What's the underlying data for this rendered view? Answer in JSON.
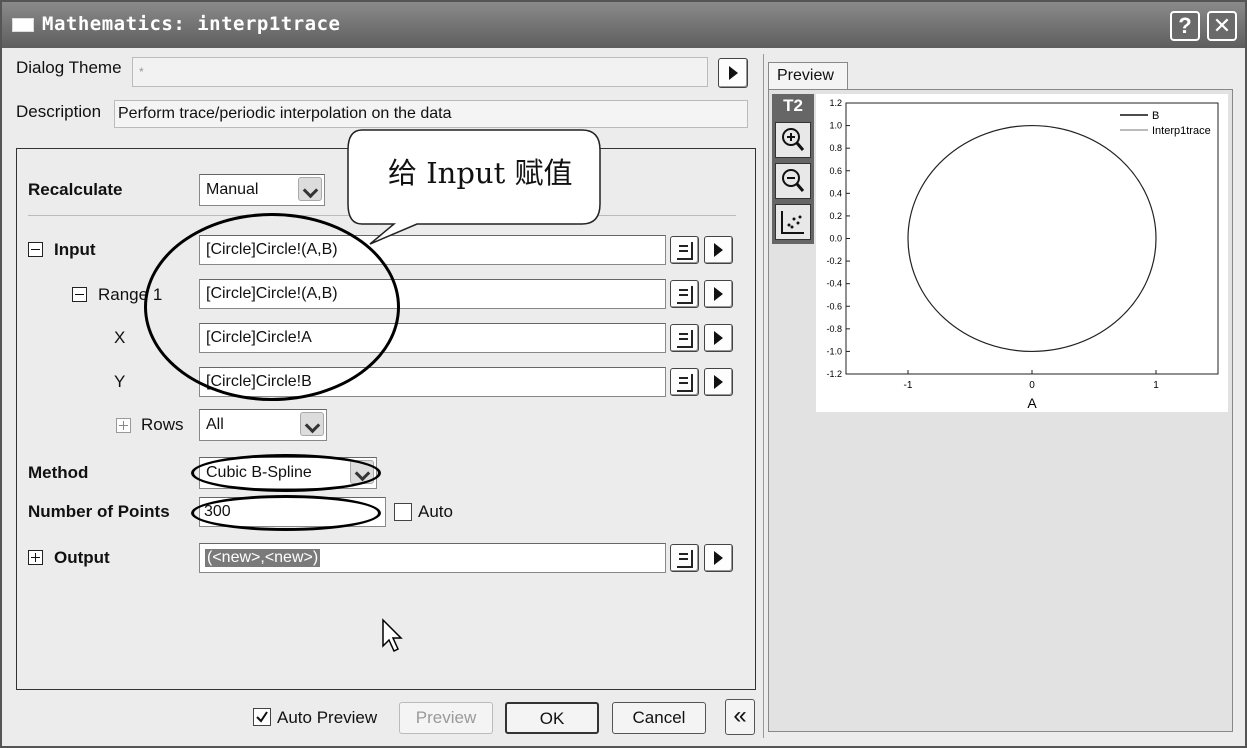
{
  "window": {
    "title": "Mathematics: interp1trace",
    "help_glyph": "?",
    "close_glyph": "✕"
  },
  "dialog_theme": {
    "label": "Dialog Theme",
    "value": "*"
  },
  "description": {
    "label": "Description",
    "value": "Perform trace/periodic interpolation on the data"
  },
  "callout": {
    "text": "给 Input 赋值"
  },
  "form": {
    "recalculate": {
      "label": "Recalculate",
      "value": "Manual"
    },
    "input": {
      "label": "Input",
      "value": "[Circle]Circle!(A,B)"
    },
    "range1": {
      "label": "Range 1",
      "value": "[Circle]Circle!(A,B)"
    },
    "x": {
      "label": "X",
      "value": "[Circle]Circle!A"
    },
    "y": {
      "label": "Y",
      "value": "[Circle]Circle!B"
    },
    "rows": {
      "label": "Rows",
      "value": "All"
    },
    "method": {
      "label": "Method",
      "value": "Cubic B-Spline"
    },
    "num_points": {
      "label": "Number of Points",
      "value": "300",
      "auto_label": "Auto",
      "auto_checked": false
    },
    "output": {
      "label": "Output",
      "value": "(<new>,<new>)"
    }
  },
  "bottom": {
    "auto_preview_label": "Auto Preview",
    "auto_preview_checked": true,
    "preview_button": "Preview",
    "ok_button": "OK",
    "cancel_button": "Cancel",
    "collapse_glyph": "«"
  },
  "preview": {
    "tab_label": "Preview",
    "layer_label": "T2",
    "legend": [
      "B",
      "Interp1trace"
    ],
    "x_axis_title": "A",
    "x_ticks": [
      "-1",
      "0",
      "1"
    ],
    "y_ticks": [
      "1.2",
      "1.0",
      "0.8",
      "0.6",
      "0.4",
      "0.2",
      "0.0",
      "-0.2",
      "-0.4",
      "-0.6",
      "-0.8",
      "-1.0",
      "-1.2"
    ]
  }
}
